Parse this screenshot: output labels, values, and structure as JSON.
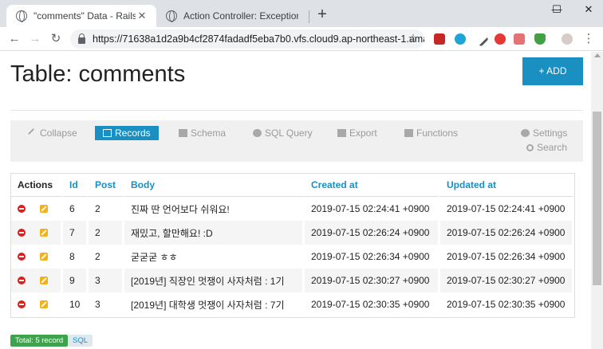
{
  "browser": {
    "tabs": [
      {
        "title": "\"comments\" Data - Rails DB"
      },
      {
        "title": "Action Controller: Exception cau"
      }
    ],
    "new_tab": "+",
    "url": "https://71638a1d2a9b4cf2874fadadf5eba7b0.vfs.cloud9.ap-northeast-1.ama...",
    "window": {
      "minimize": "—",
      "maximize": "☐",
      "close": "✕"
    }
  },
  "page": {
    "title": "Table: comments",
    "add_label": "+ ADD"
  },
  "menu": {
    "collapse": "Collapse",
    "records": "Records",
    "schema": "Schema",
    "sql_query": "SQL Query",
    "export": "Export",
    "functions": "Functions",
    "settings": "Settings",
    "search": "Search"
  },
  "table": {
    "headers": [
      "Actions",
      "Id",
      "Post",
      "Body",
      "Created at",
      "Updated at"
    ],
    "rows": [
      {
        "id": "6",
        "post": "2",
        "body": "진짜 딴 언어보다 쉬워요!",
        "created": "2019-07-15 02:24:41 +0900",
        "updated": "2019-07-15 02:24:41 +0900"
      },
      {
        "id": "7",
        "post": "2",
        "body": "재밌고, 할만해요! :D",
        "created": "2019-07-15 02:26:24 +0900",
        "updated": "2019-07-15 02:26:24 +0900"
      },
      {
        "id": "8",
        "post": "2",
        "body": "굳굳굳 ㅎㅎ",
        "created": "2019-07-15 02:26:34 +0900",
        "updated": "2019-07-15 02:26:34 +0900"
      },
      {
        "id": "9",
        "post": "3",
        "body": "[2019년] 직장인 멋쟁이 사자처럼 : 1기",
        "created": "2019-07-15 02:30:27 +0900",
        "updated": "2019-07-15 02:30:27 +0900"
      },
      {
        "id": "10",
        "post": "3",
        "body": "[2019년] 대학생 멋쟁이 사자처럼 : 7기",
        "created": "2019-07-15 02:30:35 +0900",
        "updated": "2019-07-15 02:30:35 +0900"
      }
    ]
  },
  "footer": {
    "total": "Total: 5 record",
    "sql": "SQL"
  },
  "colors": {
    "accent": "#1a8fc1",
    "total_badge": "#3fa34d",
    "delete": "#d9211e",
    "edit": "#f1b31c"
  }
}
